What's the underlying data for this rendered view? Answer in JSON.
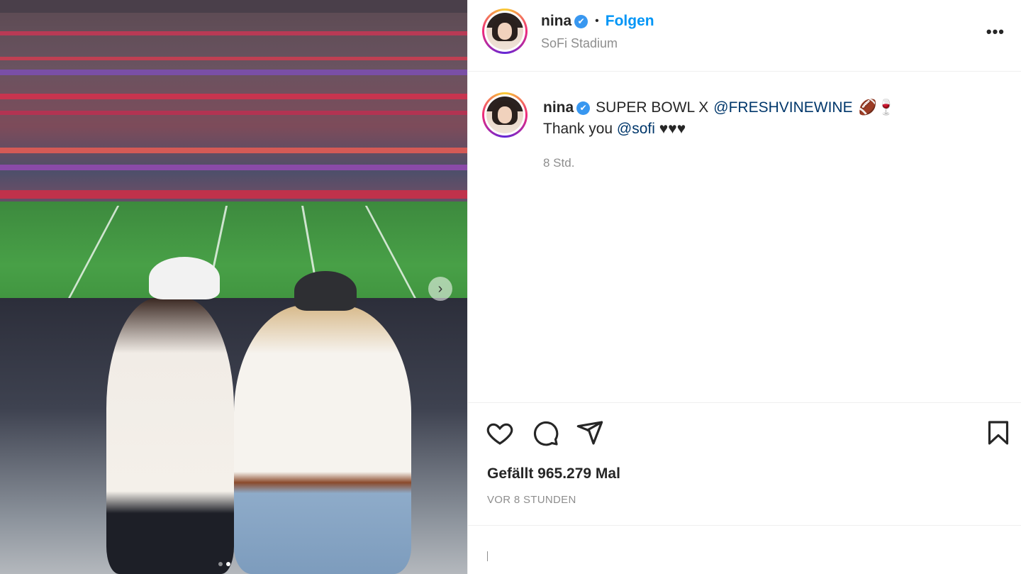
{
  "post": {
    "username": "nina",
    "verified_badge": "✔",
    "separator": "•",
    "follow_label": "Folgen",
    "location": "SoFi Stadium",
    "more_label": "•••"
  },
  "caption": {
    "username": "nina",
    "verified_badge": "✔",
    "line1_text": "SUPER BOWL X",
    "line1_mention": "@FRESHVINEWINE",
    "line1_emoji": "🏈🍷",
    "line2_text": "Thank you",
    "line2_mention": "@sofi",
    "line2_hearts": "♥♥♥",
    "time_ago": "8 Std."
  },
  "stats": {
    "likes": "Gefällt 965.279 Mal",
    "timestamp": "VOR 8 STUNDEN"
  },
  "icons": {
    "like": "heart-icon",
    "comment": "comment-icon",
    "share": "share-icon",
    "save": "bookmark-icon",
    "next": "chevron-right-icon"
  },
  "carousel": {
    "slide_count": 2,
    "active_index": 1
  },
  "colors": {
    "accent": "#0095f6",
    "verified": "#3897f0",
    "mention": "#00376b",
    "muted": "#8e8e8e",
    "text": "#262626"
  }
}
